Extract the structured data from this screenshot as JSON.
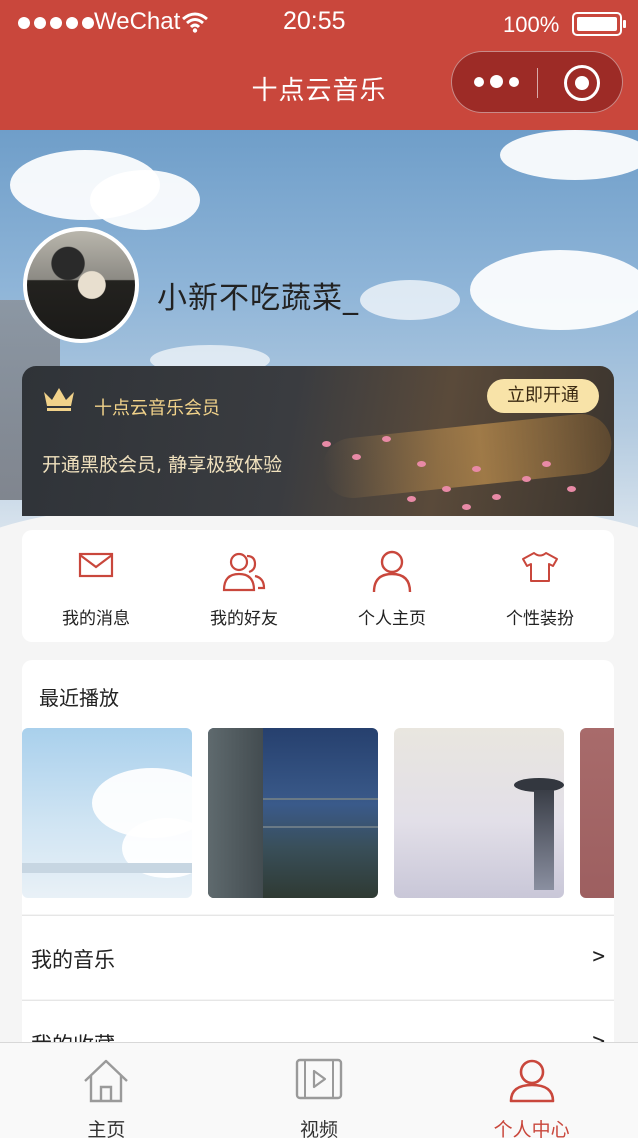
{
  "status_bar": {
    "carrier": "WeChat",
    "time": "20:55",
    "battery": "100%"
  },
  "nav": {
    "title": "十点云音乐"
  },
  "profile": {
    "username": "小新不吃蔬菜_"
  },
  "vip": {
    "title": "十点云音乐会员",
    "button": "立即开通",
    "description": "开通黑胶会员, 静享极致体验"
  },
  "quick_actions": [
    {
      "label": "我的消息",
      "icon": "mail-icon"
    },
    {
      "label": "我的好友",
      "icon": "friends-icon"
    },
    {
      "label": "个人主页",
      "icon": "user-icon"
    },
    {
      "label": "个性装扮",
      "icon": "tshirt-icon"
    }
  ],
  "recent": {
    "title": "最近播放"
  },
  "list": [
    {
      "label": "我的音乐",
      "arrow": ">"
    },
    {
      "label": "我的收藏",
      "arrow": ">"
    }
  ],
  "tabbar": [
    {
      "label": "主页",
      "icon": "home-icon",
      "active": false
    },
    {
      "label": "视频",
      "icon": "video-icon",
      "active": false
    },
    {
      "label": "个人中心",
      "icon": "person-icon",
      "active": true
    }
  ],
  "colors": {
    "brand": "#c9473c",
    "vip_gold": "#f1d28a",
    "vip_button": "#f8e3a8"
  }
}
